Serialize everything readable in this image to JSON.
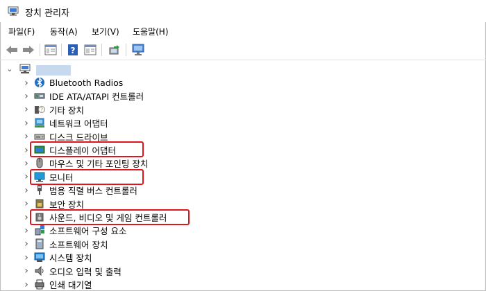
{
  "window": {
    "title": "장치 관리자"
  },
  "menu": [
    "파일(F)",
    "동작(A)",
    "보기(V)",
    "도움말(H)"
  ],
  "toolbar": {
    "buttons": [
      "back-icon",
      "forward-icon",
      "show-hide-console-tree-icon",
      "help-icon",
      "properties-icon",
      "update-driver-icon",
      "scan-hardware-icon"
    ]
  },
  "tree": {
    "root": {
      "name": ""
    },
    "categories": [
      {
        "label": "Bluetooth Radios",
        "icon": "bluetooth-icon"
      },
      {
        "label": "IDE ATA/ATAPI 컨트롤러",
        "icon": "ide-controller-icon"
      },
      {
        "label": "기타 장치",
        "icon": "unknown-device-icon"
      },
      {
        "label": "네트워크 어댑터",
        "icon": "network-adapter-icon"
      },
      {
        "label": "디스크 드라이브",
        "icon": "disk-drive-icon"
      },
      {
        "label": "디스플레이 어댑터",
        "icon": "display-adapter-icon",
        "highlighted": true
      },
      {
        "label": "마우스 및 기타 포인팅 장치",
        "icon": "mouse-icon"
      },
      {
        "label": "모니터",
        "icon": "monitor-icon",
        "highlighted": true
      },
      {
        "label": "범용 직렬 버스 컨트롤러",
        "icon": "usb-controller-icon"
      },
      {
        "label": "보안 장치",
        "icon": "security-device-icon"
      },
      {
        "label": "사운드, 비디오 및 게임 컨트롤러",
        "icon": "sound-icon",
        "highlighted": true
      },
      {
        "label": "소프트웨어 구성 요소",
        "icon": "software-component-icon"
      },
      {
        "label": "소프트웨어 장치",
        "icon": "software-device-icon"
      },
      {
        "label": "시스템 장치",
        "icon": "system-device-icon"
      },
      {
        "label": "오디오 입력 및 출력",
        "icon": "audio-io-icon"
      },
      {
        "label": "인쇄 대기열",
        "icon": "print-queue-icon"
      }
    ]
  },
  "colors": {
    "highlight": "#e0141e",
    "accent": "#1f6fc5"
  }
}
